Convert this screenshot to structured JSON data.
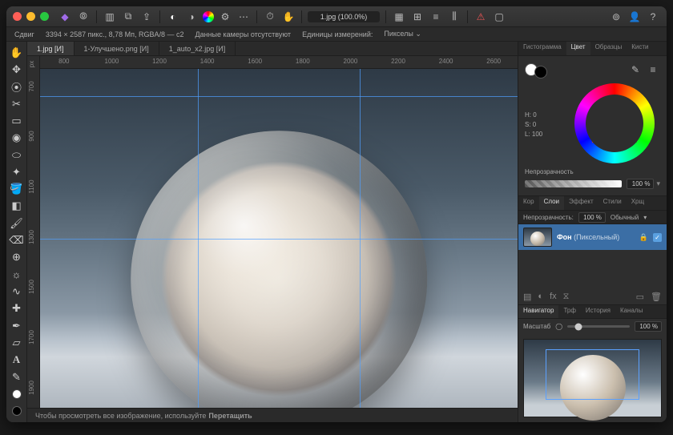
{
  "titlebar": {
    "file_label": "1.jpg (100.0%)"
  },
  "infobar": {
    "move_label": "Сдвиг",
    "dims": "3394 × 2587 пикс., 8,78 Мп, RGBA/8 — c2",
    "camera": "Данные камеры отсутствуют",
    "units_label": "Единицы измерений:",
    "units_value": "Пикселы"
  },
  "tabs": [
    {
      "label": "1.jpg [И]",
      "active": true
    },
    {
      "label": "1-Улучшено.png [И]",
      "active": false
    },
    {
      "label": "1_auto_x2.jpg [И]",
      "active": false
    }
  ],
  "ruler_unit": "px",
  "ruler_h": [
    "800",
    "1000",
    "1200",
    "1400",
    "1600",
    "1800",
    "2000",
    "2200",
    "2400",
    "2600"
  ],
  "ruler_v": [
    "700",
    "900",
    "1100",
    "1300",
    "1500",
    "1700",
    "1900"
  ],
  "status": {
    "hint_prefix": "Чтобы просмотреть все изображение, используйте ",
    "hint_bold": "Перетащить"
  },
  "panels": {
    "top_tabs": [
      "Гистограмма",
      "Цвет",
      "Образцы",
      "Кисти"
    ],
    "top_active": 1,
    "hsl": {
      "h_label": "H: 0",
      "s_label": "S: 0",
      "l_label": "L: 100"
    },
    "opacity_label": "Непрозрачность",
    "opacity_value": "100 %",
    "layer_tabs": [
      "Кор",
      "Слои",
      "Эффект",
      "Стили",
      "Хрщ"
    ],
    "layer_active": 1,
    "layer_opacity_label": "Непрозрачность:",
    "layer_opacity_value": "100 %",
    "blend_mode": "Обычный",
    "layer_name": "Фон",
    "layer_type": "(Пиксельный)",
    "nav_tabs": [
      "Навигатор",
      "Трф",
      "История",
      "Каналы"
    ],
    "nav_active": 0,
    "zoom_label": "Масштаб",
    "zoom_value": "100 %"
  }
}
